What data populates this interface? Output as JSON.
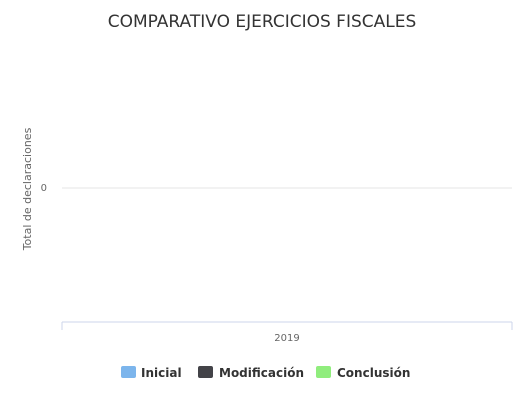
{
  "chart_data": {
    "type": "bar",
    "title": "COMPARATIVO EJERCICIOS FISCALES",
    "categories": [
      "2019"
    ],
    "series": [
      {
        "name": "Inicial",
        "color": "#7cb5ec",
        "values": [
          0
        ]
      },
      {
        "name": "Modificación",
        "color": "#434348",
        "values": [
          0
        ]
      },
      {
        "name": "Conclusión",
        "color": "#90ed7d",
        "values": [
          0
        ]
      }
    ],
    "ylabel": "Total de declaraciones",
    "xlabel": "",
    "yticks": [
      0
    ],
    "grid": true,
    "legend": "bottom-center"
  }
}
